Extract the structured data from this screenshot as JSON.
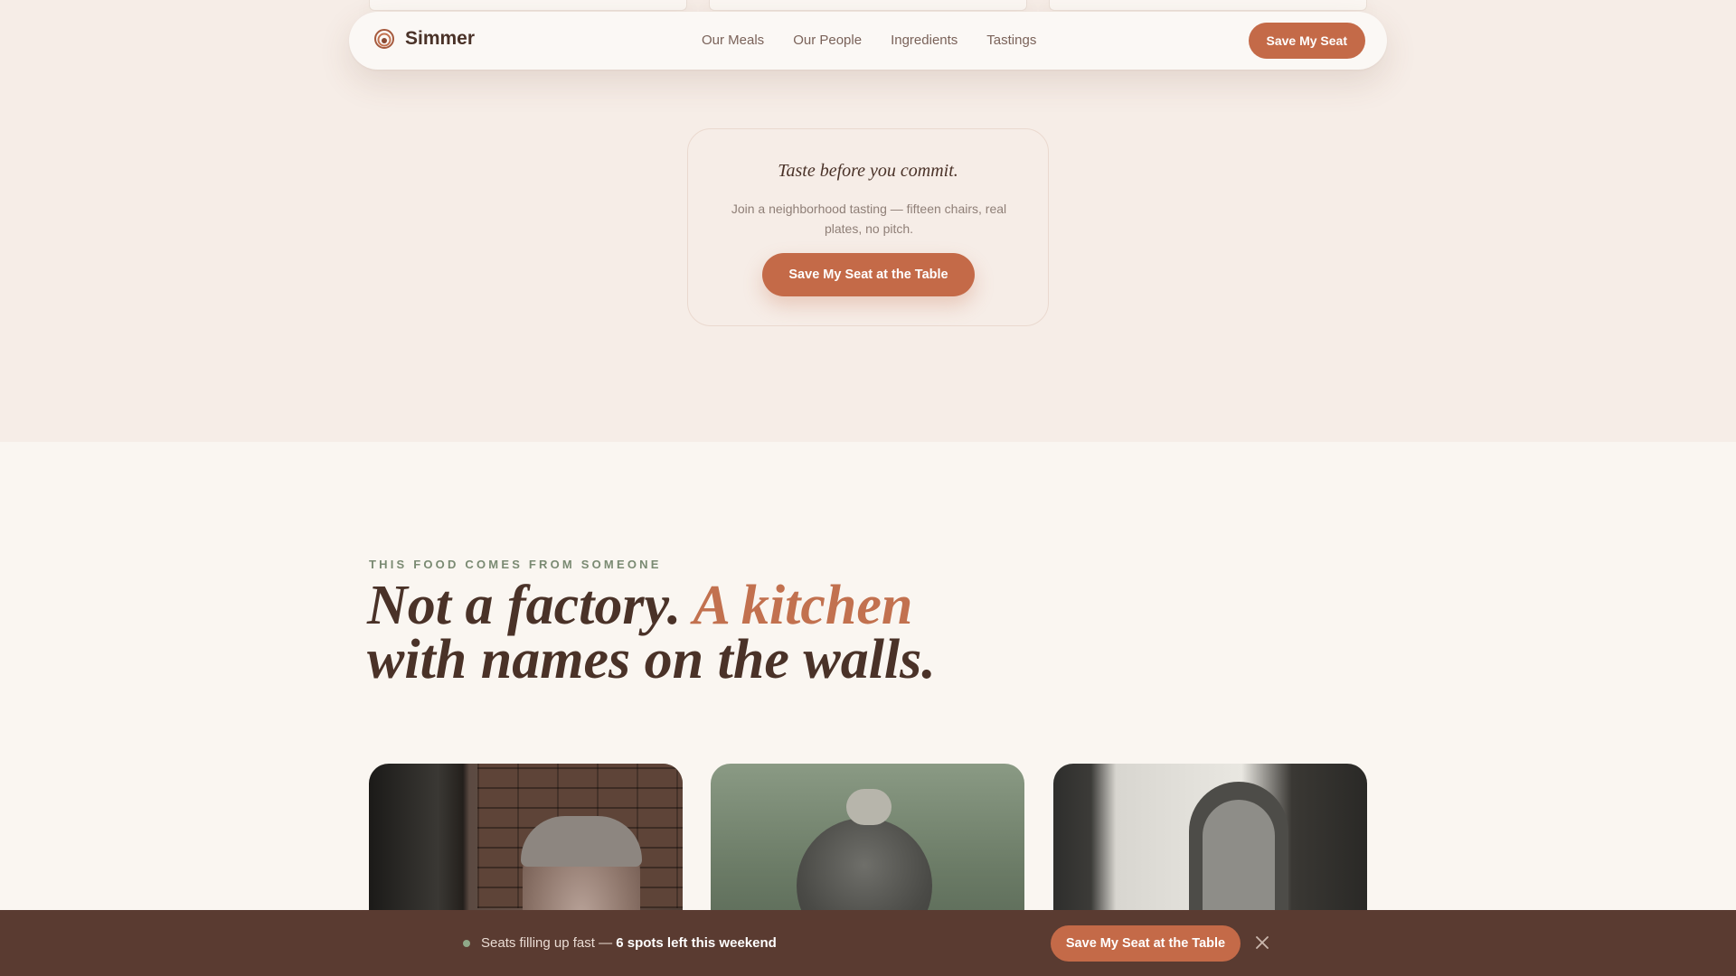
{
  "brand": {
    "name": "Simmer",
    "icon": "simmer-logo-icon"
  },
  "nav": {
    "links": [
      "Our Meals",
      "Our People",
      "Ingredients",
      "Tastings"
    ],
    "cta": "Save My Seat"
  },
  "tasting": {
    "title": "Taste before you commit.",
    "text": "Join a neighborhood tasting — fifteen chairs, real plates, no pitch.",
    "button": "Save My Seat at the Table"
  },
  "people": {
    "eyebrow": "THIS FOOD COMES FROM SOMEONE",
    "headline_part1": "Not a factory. ",
    "headline_accent": "A kitchen",
    "headline_part2": "with names on the walls."
  },
  "sticky_bar": {
    "text": "Seats filling up fast — ",
    "emphasis": "6 spots left this weekend",
    "button": "Save My Seat at the Table",
    "close_icon": "close-icon"
  },
  "colors": {
    "accent": "#c46a48",
    "headline_accent": "#c2714f",
    "dark_brown": "#4a3228",
    "bar_bg": "#5a3b31",
    "status_dot": "#8fa888"
  }
}
